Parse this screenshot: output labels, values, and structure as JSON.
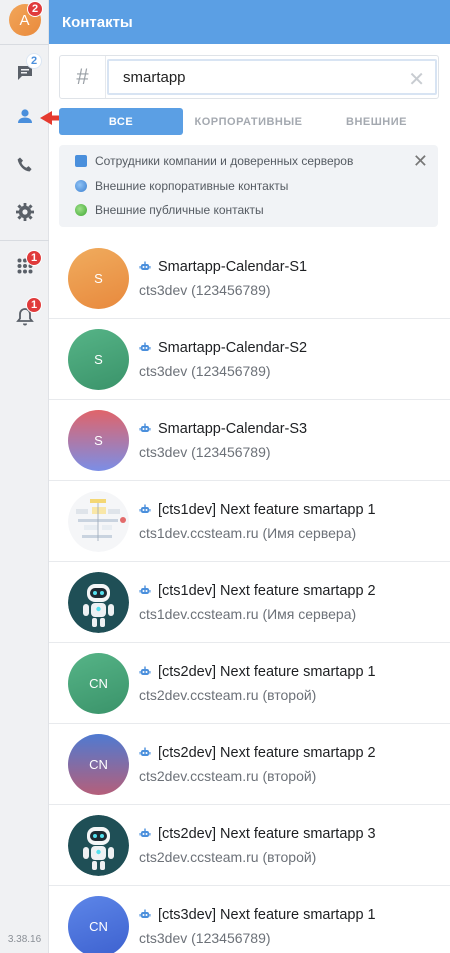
{
  "rail": {
    "avatar_letter": "A",
    "avatar_badge": "2",
    "chats_badge": "2",
    "apps_badge": "1",
    "notifications_badge": "1",
    "version": "3.38.16"
  },
  "header": {
    "title": "Контакты"
  },
  "search": {
    "hash": "#",
    "value": "smartapp",
    "placeholder": ""
  },
  "tabs": [
    {
      "label": "ВСЕ",
      "active": true
    },
    {
      "label": "КОРПОРАТИВНЫЕ",
      "active": false
    },
    {
      "label": "ВНЕШНИЕ",
      "active": false
    }
  ],
  "info": {
    "rows": [
      "Сотрудники компании и доверенных серверов",
      "Внешние корпоративные контакты",
      "Внешние публичные контакты"
    ]
  },
  "contacts": [
    {
      "initials": "S",
      "name": "Smartapp-Calendar-S1",
      "sub": "cts3dev (123456789)",
      "avatar": "orange"
    },
    {
      "initials": "S",
      "name": "Smartapp-Calendar-S2",
      "sub": "cts3dev (123456789)",
      "avatar": "green"
    },
    {
      "initials": "S",
      "name": "Smartapp-Calendar-S3",
      "sub": "cts3dev (123456789)",
      "avatar": "redblue"
    },
    {
      "initials": "",
      "name": "[cts1dev] Next feature smartapp 1",
      "sub": "cts1dev.ccsteam.ru (Имя сервера)",
      "avatar": "diagram"
    },
    {
      "initials": "",
      "name": "[cts1dev] Next feature smartapp 2",
      "sub": "cts1dev.ccsteam.ru (Имя сервера)",
      "avatar": "robot"
    },
    {
      "initials": "CN",
      "name": "[cts2dev] Next feature smartapp 1",
      "sub": "cts2dev.ccsteam.ru (второй)",
      "avatar": "green"
    },
    {
      "initials": "CN",
      "name": "[cts2dev] Next feature smartapp 2",
      "sub": "cts2dev.ccsteam.ru (второй)",
      "avatar": "bluered"
    },
    {
      "initials": "",
      "name": "[cts2dev] Next feature smartapp 3",
      "sub": "cts2dev.ccsteam.ru (второй)",
      "avatar": "robot"
    },
    {
      "initials": "CN",
      "name": "[cts3dev] Next feature smartapp 1",
      "sub": "cts3dev (123456789)",
      "avatar": "blue"
    }
  ],
  "colors": {
    "accent": "#5b9fe4",
    "badge_red": "#e03b3b",
    "arrow_red": "#e53a2f"
  }
}
